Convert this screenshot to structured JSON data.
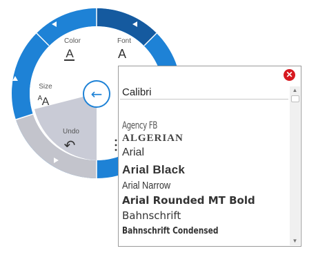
{
  "radial_menu": {
    "items": {
      "color": {
        "label": "Color",
        "icon": "A"
      },
      "font": {
        "label": "Font",
        "icon": "A"
      },
      "size": {
        "label": "Size",
        "icon_small": "A",
        "icon_large": "A"
      },
      "undo": {
        "label": "Undo",
        "icon": "↶"
      }
    },
    "back_icon": "←",
    "colors": {
      "ring": "#1e82d6",
      "ring_dark": "#155a9f",
      "ring_gray": "#c3c4cc",
      "wedge": "#c9cbd6"
    }
  },
  "font_panel": {
    "close_icon": "✕",
    "search_value": "Calibri",
    "fonts": [
      "Agency FB",
      "ALGERIAN",
      "Arial",
      "Arial Black",
      "Arial Narrow",
      "Arial Rounded MT Bold",
      "Bahnschrift",
      "Bahnschrift Condensed"
    ]
  }
}
